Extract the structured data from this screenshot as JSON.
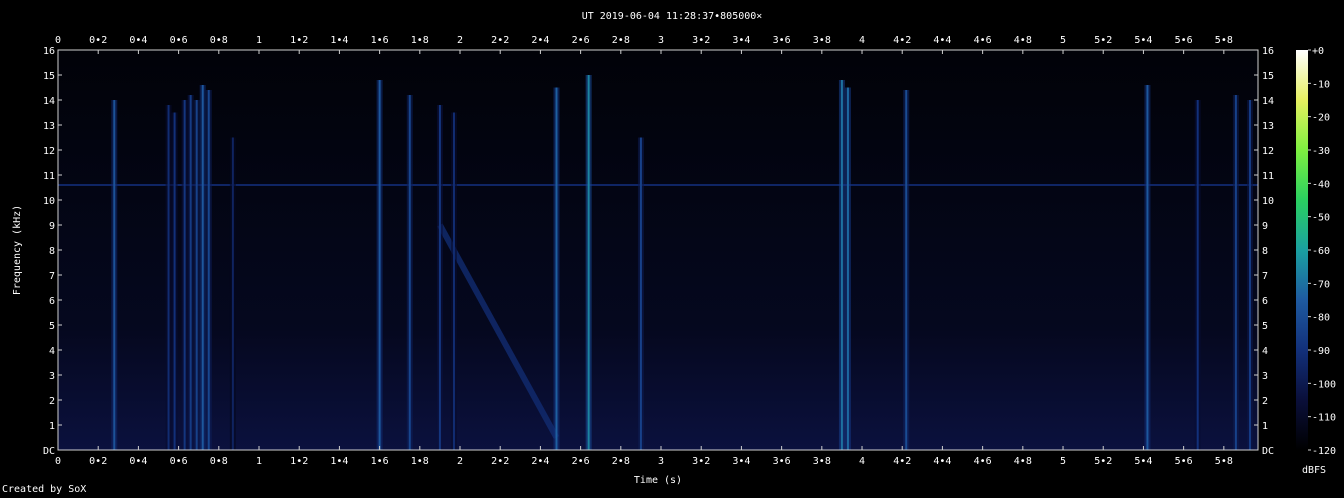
{
  "chart_data": {
    "type": "heatmap",
    "title": "UT 2019-06-04 11:28:37•805000×",
    "xlabel": "Time (s)",
    "ylabel": "Frequency (kHz)",
    "colorbar_label": "dBFS",
    "xlim": [
      0,
      5.97
    ],
    "ylim": [
      0,
      16
    ],
    "x_ticks": [
      "0",
      "0•2",
      "0•4",
      "0•6",
      "0•8",
      "1",
      "1•2",
      "1•4",
      "1•6",
      "1•8",
      "2",
      "2•2",
      "2•4",
      "2•6",
      "2•8",
      "3",
      "3•2",
      "3•4",
      "3•6",
      "3•8",
      "4",
      "4•2",
      "4•4",
      "4•6",
      "4•8",
      "5",
      "5•2",
      "5•4",
      "5•6",
      "5•8"
    ],
    "y_ticks": [
      "DC",
      "1",
      "2",
      "3",
      "4",
      "5",
      "6",
      "7",
      "8",
      "9",
      "10",
      "11",
      "12",
      "13",
      "14",
      "15",
      "16"
    ],
    "colorbar_ticks": [
      "+0",
      "-10",
      "-20",
      "-30",
      "-40",
      "-50",
      "-60",
      "-70",
      "-80",
      "-90",
      "-100",
      "-110",
      "-120"
    ],
    "colorbar_range": [
      -120,
      0
    ],
    "colormap": [
      "#000000",
      "#0a0f3a",
      "#12307a",
      "#1e5aa0",
      "#1aa0a0",
      "#2ad060",
      "#7ef040",
      "#e6f060",
      "#ffffff"
    ],
    "background_level_db": -112,
    "horizontal_line": {
      "freq_khz": 10.6,
      "level_db": -95
    },
    "events": [
      {
        "t": 0.28,
        "fmax": 14.0,
        "level_db": -78
      },
      {
        "t": 0.55,
        "fmax": 13.8,
        "level_db": -92
      },
      {
        "t": 0.58,
        "fmax": 13.5,
        "level_db": -90
      },
      {
        "t": 0.63,
        "fmax": 14.0,
        "level_db": -88
      },
      {
        "t": 0.66,
        "fmax": 14.2,
        "level_db": -86
      },
      {
        "t": 0.69,
        "fmax": 14.0,
        "level_db": -84
      },
      {
        "t": 0.72,
        "fmax": 14.6,
        "level_db": -76
      },
      {
        "t": 0.75,
        "fmax": 14.4,
        "level_db": -82
      },
      {
        "t": 0.87,
        "fmax": 12.5,
        "level_db": -96
      },
      {
        "t": 1.6,
        "fmax": 14.8,
        "level_db": -76
      },
      {
        "t": 1.75,
        "fmax": 14.2,
        "level_db": -82
      },
      {
        "t": 1.9,
        "fmax": 13.8,
        "level_db": -88
      },
      {
        "t": 1.97,
        "fmax": 13.5,
        "level_db": -92
      },
      {
        "t": 2.48,
        "fmax": 14.5,
        "level_db": -74
      },
      {
        "t": 2.64,
        "fmax": 15.0,
        "level_db": -66
      },
      {
        "t": 2.9,
        "fmax": 12.5,
        "level_db": -84
      },
      {
        "t": 3.9,
        "fmax": 14.8,
        "level_db": -70
      },
      {
        "t": 3.93,
        "fmax": 14.5,
        "level_db": -72
      },
      {
        "t": 4.22,
        "fmax": 14.4,
        "level_db": -80
      },
      {
        "t": 5.42,
        "fmax": 14.6,
        "level_db": -76
      },
      {
        "t": 5.67,
        "fmax": 14.0,
        "level_db": -90
      },
      {
        "t": 5.86,
        "fmax": 14.2,
        "level_db": -84
      },
      {
        "t": 5.93,
        "fmax": 14.0,
        "level_db": -86
      }
    ],
    "sweep": {
      "t_start": 1.9,
      "f_start_khz": 9.0,
      "t_end": 2.48,
      "f_end_khz": 0.5,
      "level_db": -92
    }
  },
  "credit": "Created by SoX"
}
